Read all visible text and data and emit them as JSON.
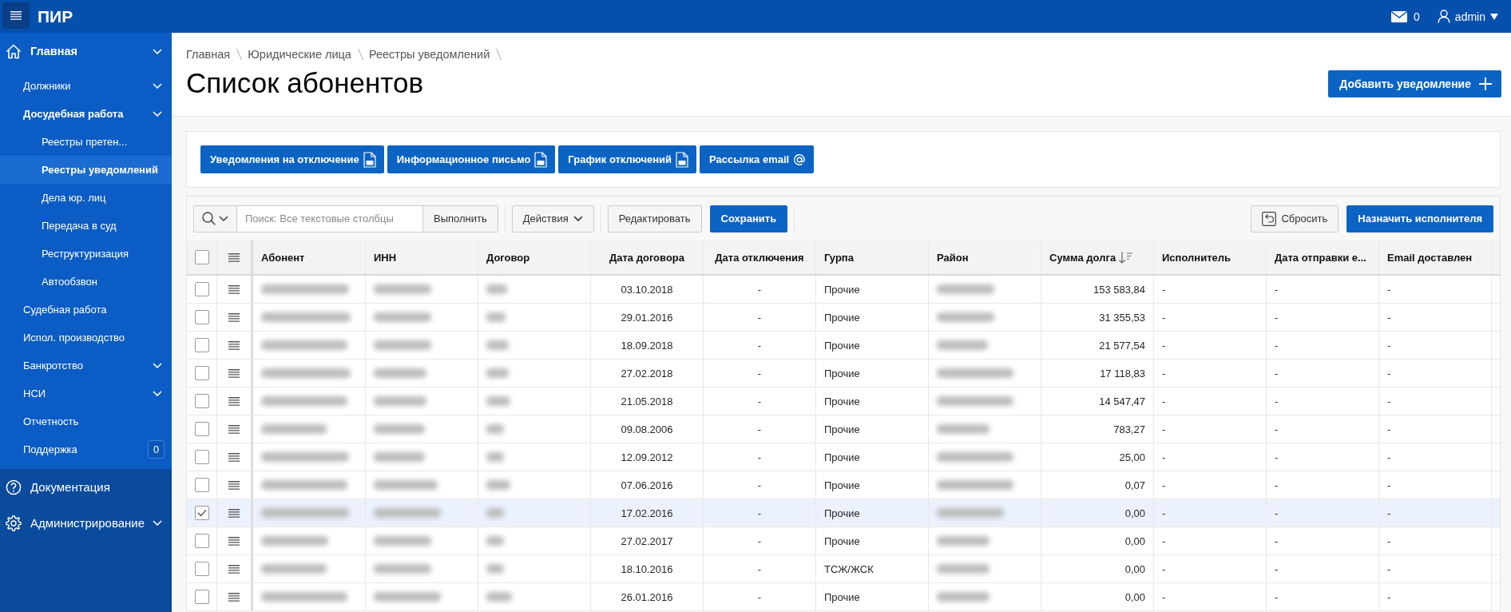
{
  "topbar": {
    "logo": "ПИР",
    "messages": "0",
    "user": "admin"
  },
  "sidebar": {
    "items": [
      {
        "label": "Главная",
        "expandable": true,
        "selected": false,
        "children": [
          {
            "label": "Должники",
            "expandable": true,
            "selected": false
          },
          {
            "label": "Досудебная работа",
            "expandable": true,
            "selected": false,
            "children": [
              {
                "label": "Реестры претен...",
                "expandable": false,
                "selected": false
              },
              {
                "label": "Реестры уведомлений",
                "expandable": false,
                "selected": true
              },
              {
                "label": "Дела юр. лиц",
                "expandable": false,
                "selected": false
              },
              {
                "label": "Передача в суд",
                "expandable": false,
                "selected": false
              },
              {
                "label": "Реструктуризация",
                "expandable": false,
                "selected": false
              },
              {
                "label": "Автообзвон",
                "expandable": false,
                "selected": false
              }
            ]
          },
          {
            "label": "Судебная работа",
            "expandable": false,
            "selected": false
          },
          {
            "label": "Испол. производство",
            "expandable": false,
            "selected": false
          },
          {
            "label": "Банкротство",
            "expandable": true,
            "selected": false
          },
          {
            "label": "НСИ",
            "expandable": true,
            "selected": false
          },
          {
            "label": "Отчетность",
            "expandable": false,
            "selected": false
          },
          {
            "label": "Поддержка",
            "expandable": false,
            "selected": false,
            "badge": "0"
          }
        ]
      }
    ],
    "footer_items": [
      {
        "label": "Документация",
        "expandable": false,
        "selected": false
      },
      {
        "label": "Администрирование",
        "expandable": true,
        "selected": false
      }
    ]
  },
  "breadcrumb": {
    "items": [
      "Главная",
      "Юридические лица",
      "Реестры уведомлений"
    ]
  },
  "page": {
    "title": "Список абонентов",
    "add_button": "Добавить уведомление"
  },
  "document_buttons": [
    {
      "label": "Уведомления на отключение",
      "kind": "pdf"
    },
    {
      "label": "Информационное письмо",
      "kind": "pdf"
    },
    {
      "label": "График отключений",
      "kind": "pdf"
    },
    {
      "label": "Рассылка email",
      "kind": "email"
    }
  ],
  "toolbar": {
    "search": {
      "placeholder": "Поиск: Все текстовые столбцы"
    },
    "go_button": "Выполнить",
    "actions_menu": "Действия",
    "edit_button": "Редактировать",
    "save_button": "Сохранить",
    "reset_button": "Сбросить",
    "assign_button": "Назначить исполнителя"
  },
  "table": {
    "select_all_checked": false,
    "columns": [
      {
        "label": "Абонент",
        "kind": "blurred",
        "sorted": false
      },
      {
        "label": "ИНН",
        "kind": "blurred",
        "sorted": false
      },
      {
        "label": "Договор",
        "kind": "blurred",
        "sorted": false
      },
      {
        "label": "Дата договора",
        "kind": "date",
        "sorted": false
      },
      {
        "label": "Дата отключения",
        "kind": "date",
        "sorted": false
      },
      {
        "label": "Гурпа",
        "kind": "text",
        "sorted": false
      },
      {
        "label": "Район",
        "kind": "blurred",
        "sorted": false
      },
      {
        "label": "Сумма долга",
        "kind": "number",
        "sorted": true
      },
      {
        "label": "Исполнитель",
        "kind": "text",
        "sorted": false
      },
      {
        "label": "Дата отправки е...",
        "kind": "text",
        "sorted": false
      },
      {
        "label": "Email доставлен",
        "kind": "text",
        "sorted": false
      }
    ],
    "rows": [
      {
        "selected": false,
        "cells": [
          "",
          "",
          "",
          "03.10.2018",
          "-",
          "Прочие",
          "",
          "153 583,84",
          "-",
          "-",
          "-"
        ]
      },
      {
        "selected": false,
        "cells": [
          "",
          "",
          "",
          "29.01.2016",
          "-",
          "Прочие",
          "",
          "31 355,53",
          "-",
          "-",
          "-"
        ]
      },
      {
        "selected": false,
        "cells": [
          "",
          "",
          "",
          "18.09.2018",
          "-",
          "Прочие",
          "",
          "21 577,54",
          "-",
          "-",
          "-"
        ]
      },
      {
        "selected": false,
        "cells": [
          "",
          "",
          "",
          "27.02.2018",
          "-",
          "Прочие",
          "",
          "17 118,83",
          "-",
          "-",
          "-"
        ]
      },
      {
        "selected": false,
        "cells": [
          "",
          "",
          "",
          "21.05.2018",
          "-",
          "Прочие",
          "",
          "14 547,47",
          "-",
          "-",
          "-"
        ]
      },
      {
        "selected": false,
        "cells": [
          "",
          "",
          "",
          "09.08.2006",
          "-",
          "Прочие",
          "",
          "783,27",
          "-",
          "-",
          "-"
        ]
      },
      {
        "selected": false,
        "cells": [
          "",
          "",
          "",
          "12.09.2012",
          "-",
          "Прочие",
          "",
          "25,00",
          "-",
          "-",
          "-"
        ]
      },
      {
        "selected": false,
        "cells": [
          "",
          "",
          "",
          "07.06.2016",
          "-",
          "Прочие",
          "",
          "0,07",
          "-",
          "-",
          "-"
        ]
      },
      {
        "selected": true,
        "cells": [
          "",
          "",
          "",
          "17.02.2016",
          "-",
          "Прочие",
          "",
          "0,00",
          "-",
          "-",
          "-"
        ]
      },
      {
        "selected": false,
        "cells": [
          "",
          "",
          "",
          "27.02.2017",
          "-",
          "Прочие",
          "",
          "0,00",
          "-",
          "-",
          "-"
        ]
      },
      {
        "selected": false,
        "cells": [
          "",
          "",
          "",
          "18.10.2016",
          "-",
          "ТСЖ/ЖСК",
          "",
          "0,00",
          "-",
          "-",
          "-"
        ]
      },
      {
        "selected": false,
        "cells": [
          "",
          "",
          "",
          "26.01.2016",
          "-",
          "Прочие",
          "",
          "0,00",
          "-",
          "-",
          "-"
        ]
      }
    ]
  }
}
